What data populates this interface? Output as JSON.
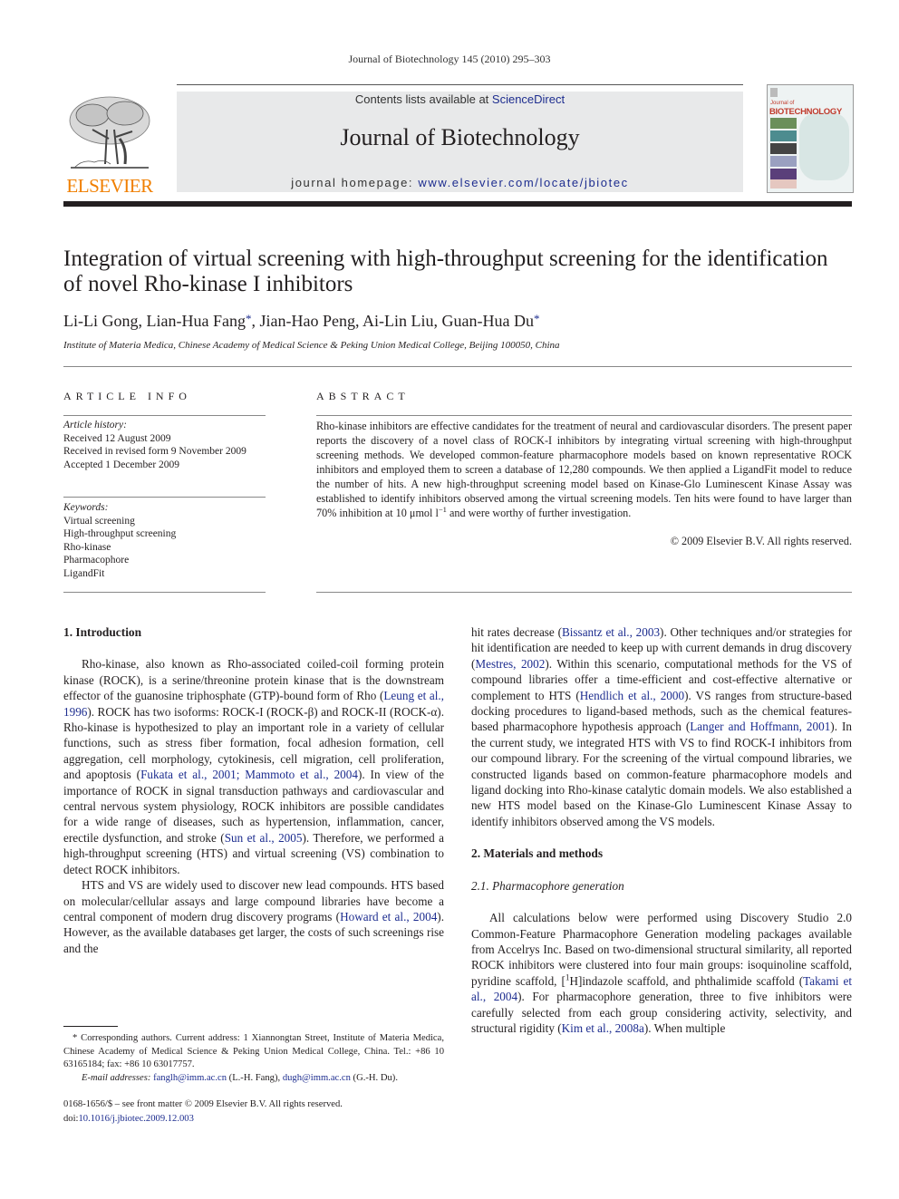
{
  "running_head": "Journal of Biotechnology 145 (2010) 295–303",
  "masthead": {
    "publisher_logo_text": "ELSEVIER",
    "contents_prefix": "Contents lists available at ",
    "contents_link": "ScienceDirect",
    "journal_title": "Journal of Biotechnology",
    "homepage_prefix": "journal homepage: ",
    "homepage_link": "www.elsevier.com/locate/jbiotec",
    "cover_small": "Journal of",
    "cover_big": "BIOTECHNOLOGY",
    "colors": {
      "elsevier_orange": "#f07f00",
      "link_blue": "#1d2d8f",
      "masthead_gray": "#e8e9ea",
      "cover_red": "#c0392b"
    }
  },
  "article": {
    "title": "Integration of virtual screening with high-throughput screening for the identification of novel Rho-kinase I inhibitors",
    "authors": [
      {
        "name": "Li-Li Gong",
        "corresponding": false,
        "sep": ", "
      },
      {
        "name": "Lian-Hua Fang",
        "corresponding": true,
        "sep": ", "
      },
      {
        "name": "Jian-Hao Peng",
        "corresponding": false,
        "sep": ", "
      },
      {
        "name": "Ai-Lin Liu",
        "corresponding": false,
        "sep": ", "
      },
      {
        "name": "Guan-Hua Du",
        "corresponding": true,
        "sep": ""
      }
    ],
    "corresponding_mark": "*",
    "affiliation": "Institute of Materia Medica, Chinese Academy of Medical Science & Peking Union Medical College, Beijing 100050, China"
  },
  "article_info": {
    "heading": "ARTICLE INFO",
    "history_label": "Article history:",
    "history": [
      "Received 12 August 2009",
      "Received in revised form 9 November 2009",
      "Accepted 1 December 2009"
    ],
    "keywords_label": "Keywords:",
    "keywords": [
      "Virtual screening",
      "High-throughput screening",
      "Rho-kinase",
      "Pharmacophore",
      "LigandFit"
    ]
  },
  "abstract": {
    "heading": "ABSTRACT",
    "text_before_unit": "Rho-kinase inhibitors are effective candidates for the treatment of neural and cardiovascular disorders. The present paper reports the discovery of a novel class of ROCK-I inhibitors by integrating virtual screening with high-throughput screening methods. We developed common-feature pharmacophore models based on known representative ROCK inhibitors and employed them to screen a database of 12,280 compounds. We then applied a LigandFit model to reduce the number of hits. A new high-throughput screening model based on Kinase-Glo Luminescent Kinase Assay was established to identify inhibitors observed among the virtual screening models. Ten hits were found to have larger than 70% inhibition at 10 μmol l",
    "unit_sup": "−1",
    "text_after_unit": " and were worthy of further investigation.",
    "copyright": "© 2009 Elsevier B.V. All rights reserved."
  },
  "body": {
    "sec1_heading": "1.  Introduction",
    "p1": [
      {
        "t": "Rho-kinase, also known as Rho-associated coiled-coil forming protein kinase (ROCK), is a serine/threonine protein kinase that is the downstream effector of the guanosine triphosphate (GTP)-bound form of Rho ("
      },
      {
        "link": "Leung et al., 1996"
      },
      {
        "t": "). ROCK has two isoforms: ROCK-I (ROCK-β) and ROCK-II (ROCK-α). Rho-kinase is hypothesized to play an important role in a variety of cellular functions, such as stress fiber formation, focal adhesion formation, cell aggregation, cell morphology, cytokinesis, cell migration, cell proliferation, and apoptosis ("
      },
      {
        "link": "Fukata et al., 2001; Mammoto et al., 2004"
      },
      {
        "t": "). In view of the importance of ROCK in signal transduction pathways and cardiovascular and central nervous system physiology, ROCK inhibitors are possible candidates for a wide range of diseases, such as hypertension, inflammation, cancer, erectile dysfunction, and stroke ("
      },
      {
        "link": "Sun et al., 2005"
      },
      {
        "t": "). Therefore, we performed a high-throughput screening (HTS) and virtual screening (VS) combination to detect ROCK inhibitors."
      }
    ],
    "p2": [
      {
        "t": "HTS and VS are widely used to discover new lead compounds. HTS based on molecular/cellular assays and large compound libraries have become a central component of modern drug discovery programs ("
      },
      {
        "link": "Howard et al., 2004"
      },
      {
        "t": "). However, as the available databases get larger, the costs of such screenings rise and the "
      }
    ],
    "p2_cont": [
      {
        "t": "hit rates decrease ("
      },
      {
        "link": "Bissantz et al., 2003"
      },
      {
        "t": "). Other techniques and/or strategies for hit identification are needed to keep up with current demands in drug discovery ("
      },
      {
        "link": "Mestres, 2002"
      },
      {
        "t": "). Within this scenario, computational methods for the VS of compound libraries offer a time-efficient and cost-effective alternative or complement to HTS ("
      },
      {
        "link": "Hendlich et al., 2000"
      },
      {
        "t": "). VS ranges from structure-based docking procedures to ligand-based methods, such as the chemical features-based pharmacophore hypothesis approach ("
      },
      {
        "link": "Langer and Hoffmann, 2001"
      },
      {
        "t": "). In the current study, we integrated HTS with VS to find ROCK-I inhibitors from our compound library. For the screening of the virtual compound libraries, we constructed ligands based on common-feature pharmacophore models and ligand docking into Rho-kinase catalytic domain models. We also established a new HTS model based on the Kinase-Glo Luminescent Kinase Assay to identify inhibitors observed among the VS models."
      }
    ],
    "sec2_heading": "2.  Materials and methods",
    "sec21_heading": "2.1.  Pharmacophore generation",
    "p3": [
      {
        "t": "All calculations below were performed using Discovery Studio 2.0 Common-Feature Pharmacophore Generation modeling packages available from Accelrys Inc. Based on two-dimensional structural similarity, all reported ROCK inhibitors were clustered into four main groups: isoquinoline scaffold, pyridine scaffold, ["
      },
      {
        "sup": "1"
      },
      {
        "t": "H]indazole scaffold, and phthalimide scaffold ("
      },
      {
        "link": "Takami et al., 2004"
      },
      {
        "t": "). For pharmacophore generation, three to five inhibitors were carefully selected from each group considering activity, selectivity, and structural rigidity ("
      },
      {
        "link": "Kim et al., 2008a"
      },
      {
        "t": "). When multiple"
      }
    ]
  },
  "footnotes": {
    "corresponding": "* Corresponding authors. Current address: 1 Xiannongtan Street, Institute of Materia Medica, Chinese Academy of Medical Science & Peking Union Medical College, China. Tel.: +86 10 63165184; fax: +86 10 63017757.",
    "email_label": "E-mail addresses:",
    "email1": "fanglh@imm.ac.cn",
    "email1_owner": " (L.-H. Fang), ",
    "email2": "dugh@imm.ac.cn",
    "email2_owner": " (G.-H. Du)."
  },
  "front_matter": {
    "issn_line": "0168-1656/$ – see front matter © 2009 Elsevier B.V. All rights reserved.",
    "doi_prefix": "doi:",
    "doi": "10.1016/j.jbiotec.2009.12.003"
  }
}
